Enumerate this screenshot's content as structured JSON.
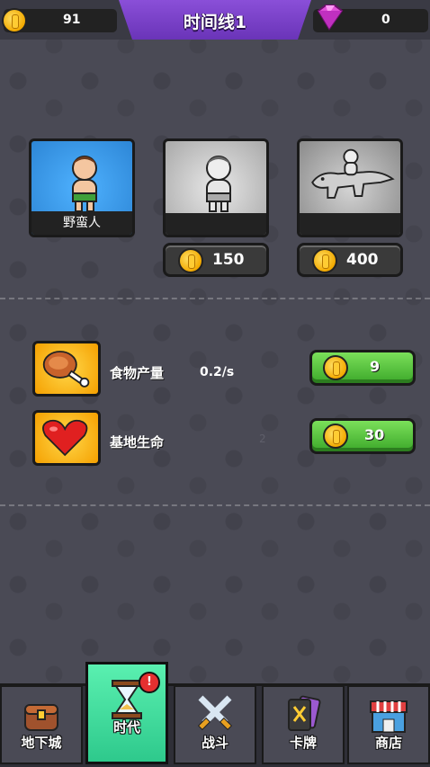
{
  "header": {
    "coins": "91",
    "gems": "0",
    "title": "时间线1"
  },
  "characters": [
    {
      "name": "野蛮人",
      "state": "unlocked"
    },
    {
      "name": "",
      "state": "locked",
      "price": "150"
    },
    {
      "name": "",
      "state": "locked",
      "price": "400"
    }
  ],
  "upgrades": [
    {
      "label": "食物产量",
      "value": "0.2/s",
      "cost": "9",
      "icon": "meat-icon"
    },
    {
      "label": "基地生命",
      "value": "2",
      "cost": "30",
      "icon": "heart-icon"
    }
  ],
  "nav": [
    {
      "label": "地下城",
      "icon": "chest-icon",
      "active": false
    },
    {
      "label": "时代",
      "icon": "hourglass-icon",
      "active": true,
      "badge": "!"
    },
    {
      "label": "战斗",
      "icon": "crossed-swords-icon",
      "active": false
    },
    {
      "label": "卡牌",
      "icon": "cards-icon",
      "active": false
    },
    {
      "label": "商店",
      "icon": "shop-icon",
      "active": false
    }
  ],
  "colors": {
    "accent_purple": "#7a42c8",
    "button_green": "#4cc030",
    "active_tab": "#3ad89c"
  }
}
